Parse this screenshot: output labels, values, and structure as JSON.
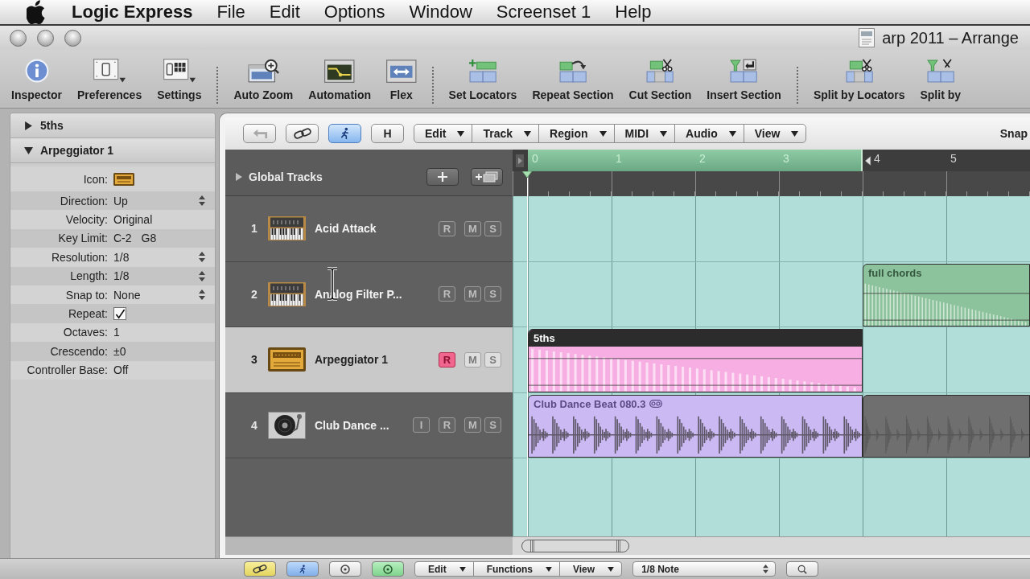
{
  "menu_bar": {
    "items": [
      {
        "label": "Logic Express",
        "kind": "app"
      },
      {
        "label": "File",
        "kind": "menu"
      },
      {
        "label": "Edit",
        "kind": "menu"
      },
      {
        "label": "Options",
        "kind": "menu"
      },
      {
        "label": "Window",
        "kind": "menu"
      },
      {
        "label": "Screenset 1",
        "kind": "menu"
      },
      {
        "label": "Help",
        "kind": "menu"
      }
    ]
  },
  "window": {
    "title": "arp 2011 – Arrange"
  },
  "toolbar": {
    "groups": [
      [
        "Inspector",
        "Preferences",
        "Settings"
      ],
      [
        "Auto Zoom",
        "Automation",
        "Flex"
      ],
      [
        "Set Locators",
        "Repeat Section",
        "Cut Section",
        "Insert Section"
      ],
      [
        "Split by Locators",
        "Split by"
      ]
    ]
  },
  "inspector": {
    "sections": [
      {
        "title": "5ths",
        "expanded": false
      },
      {
        "title": "Arpeggiator 1",
        "expanded": true,
        "parameters": [
          {
            "label": "Icon:",
            "kind": "icon"
          },
          {
            "label": "Direction:",
            "kind": "popup",
            "value": "Up"
          },
          {
            "label": "Velocity:",
            "kind": "value",
            "value": "Original"
          },
          {
            "label": "Key Limit:",
            "kind": "range",
            "values": [
              "C-2",
              "G8"
            ]
          },
          {
            "label": "Resolution:",
            "kind": "popup",
            "value": "1/8"
          },
          {
            "label": "Length:",
            "kind": "popup",
            "value": "1/8"
          },
          {
            "label": "Snap to:",
            "kind": "popup",
            "value": "None"
          },
          {
            "label": "Repeat:",
            "kind": "checkbox",
            "checked": true
          },
          {
            "label": "Octaves:",
            "kind": "value",
            "value": "1"
          },
          {
            "label": "Crescendo:",
            "kind": "value",
            "value": "±0"
          },
          {
            "label": "Controller Base:",
            "kind": "value",
            "value": "Off"
          }
        ]
      }
    ]
  },
  "arrange": {
    "tool_buttons": [
      {
        "kind": "icon",
        "on": false
      },
      {
        "kind": "icon",
        "on": false
      },
      {
        "kind": "icon",
        "on": true
      },
      {
        "kind": "text",
        "label": "H",
        "on": false
      }
    ],
    "menus": [
      "Edit",
      "Track",
      "Region",
      "MIDI",
      "Audio",
      "View"
    ],
    "snap_label": "Snap",
    "global_tracks": {
      "label": "Global Tracks",
      "expanded": false
    },
    "ruler": {
      "cycle_on": true,
      "bars": [
        "0",
        "1",
        "2",
        "3",
        "4",
        "5"
      ]
    },
    "tracks": [
      {
        "number": "1",
        "name": "Acid Attack",
        "kind": "instrument",
        "selected": false,
        "buttons": [
          {
            "kind": "record",
            "label": "R",
            "on": false
          },
          {
            "kind": "mute",
            "label": "M",
            "on": false
          },
          {
            "kind": "solo",
            "label": "S",
            "on": false
          }
        ]
      },
      {
        "number": "2",
        "name": "Analog Filter P...",
        "kind": "instrument",
        "selected": false,
        "buttons": [
          {
            "kind": "record",
            "label": "R",
            "on": false
          },
          {
            "kind": "mute",
            "label": "M",
            "on": false
          },
          {
            "kind": "solo",
            "label": "S",
            "on": false
          }
        ],
        "regions": [
          {
            "name": "full chords",
            "kind": "midi",
            "color": "#8dc39c",
            "selected": false
          }
        ]
      },
      {
        "number": "3",
        "name": "Arpeggiator 1",
        "kind": "arpeggiator",
        "selected": true,
        "buttons": [
          {
            "kind": "record",
            "label": "R",
            "on": true
          },
          {
            "kind": "mute",
            "label": "M",
            "on": false
          },
          {
            "kind": "solo",
            "label": "S",
            "on": false
          }
        ],
        "regions": [
          {
            "name": "5ths",
            "kind": "midi",
            "color": "#f7aee3",
            "selected": true
          }
        ]
      },
      {
        "number": "4",
        "name": "Club Dance ...",
        "kind": "audio",
        "selected": false,
        "buttons": [
          {
            "kind": "input",
            "label": "I",
            "on": false
          },
          {
            "kind": "record",
            "label": "R",
            "on": false
          },
          {
            "kind": "mute",
            "label": "M",
            "on": false
          },
          {
            "kind": "solo",
            "label": "S",
            "on": false
          }
        ],
        "regions": [
          {
            "name": "Club Dance Beat 080.3",
            "kind": "audio",
            "color": "#cbb9f4",
            "selected": false
          },
          {
            "kind": "loop",
            "color": "#6f6f6f",
            "selected": false
          }
        ]
      }
    ]
  },
  "bottom_bar": {
    "menus": [
      "Edit",
      "Functions",
      "View"
    ],
    "quantize": "1/8 Note"
  }
}
